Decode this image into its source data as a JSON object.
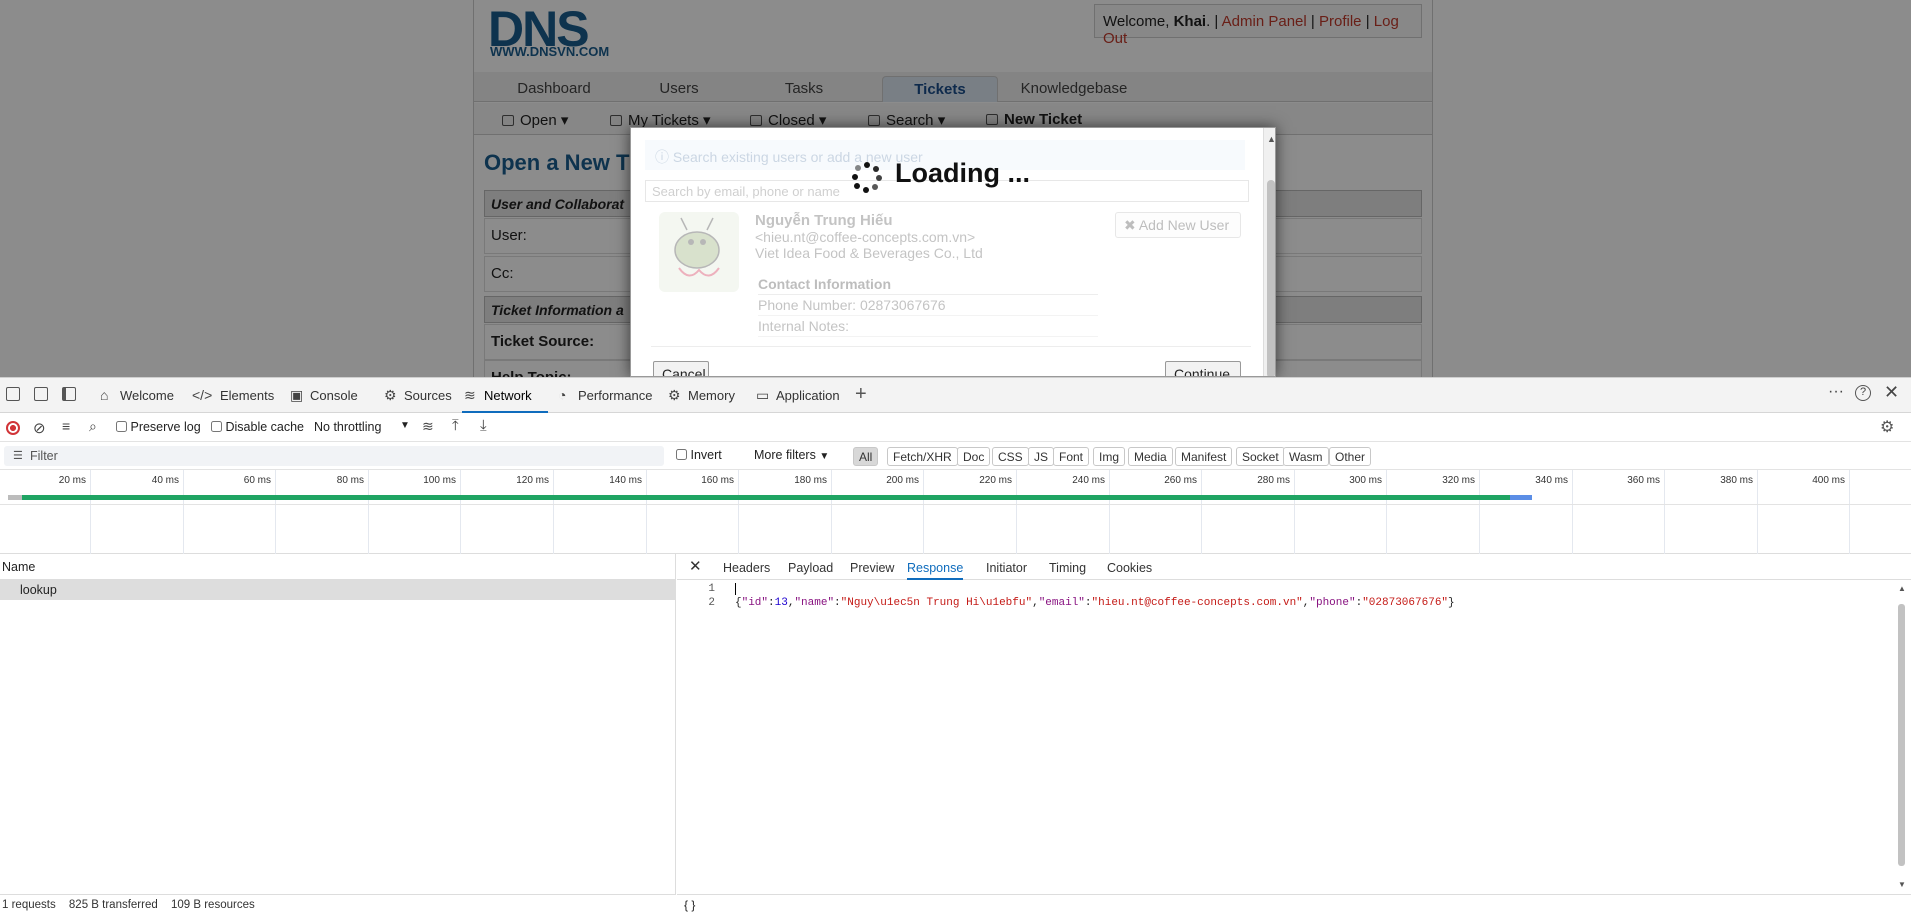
{
  "site": {
    "logo_text": "DNS",
    "logo_url": "WWW.DNSVN.COM",
    "welcome_prefix": "Welcome, ",
    "welcome_user": "Khai",
    "welcome_suffix": ". |",
    "admin_panel": "Admin Panel",
    "profile": "Profile",
    "logout": "Log Out",
    "sep": "|",
    "tabs": [
      "Dashboard",
      "Users",
      "Tasks",
      "Tickets",
      "Knowledgebase"
    ],
    "subnav": [
      "Open ▾",
      "My Tickets ▾",
      "Closed ▾",
      "Search ▾",
      "New Ticket"
    ],
    "page_title": "Open a New Tic",
    "section1": "User and Collaborat",
    "row_user": "User:",
    "row_cc": "Cc:",
    "section2": "Ticket Information a",
    "row_source": "Ticket Source:",
    "row_help": "Help Topic:"
  },
  "modal": {
    "info": "Search existing users or add a new user",
    "search_placeholder": "Search by email, phone or name",
    "user_name": "Nguyễn Trung Hiếu",
    "user_email": "<hieu.nt@coffee-concepts.com.vn>",
    "user_org": "Viet Idea Food & Beverages Co., Ltd",
    "add_new_user": "✖ Add New User",
    "contact_heading": "Contact Information",
    "phone": "Phone Number: 02873067676",
    "notes": "Internal Notes:",
    "cancel": "Cancel",
    "continue": "Continue",
    "loading": "Loading ..."
  },
  "devtools": {
    "tabs": [
      "Welcome",
      "Elements",
      "Console",
      "Sources",
      "Network",
      "Performance",
      "Memory",
      "Application"
    ],
    "active_tab": "Network",
    "toolbar": {
      "preserve_log": "Preserve log",
      "disable_cache": "Disable cache",
      "throttling": "No throttling"
    },
    "filter": {
      "placeholder": "Filter",
      "invert": "Invert",
      "more_filters": "More filters",
      "types": [
        "All",
        "Fetch/XHR",
        "Doc",
        "CSS",
        "JS",
        "Font",
        "Img",
        "Media",
        "Manifest",
        "Socket",
        "Wasm",
        "Other"
      ]
    },
    "timeline_ticks": [
      "20 ms",
      "40 ms",
      "60 ms",
      "80 ms",
      "100 ms",
      "120 ms",
      "140 ms",
      "160 ms",
      "180 ms",
      "200 ms",
      "220 ms",
      "240 ms",
      "260 ms",
      "280 ms",
      "300 ms",
      "320 ms",
      "340 ms",
      "360 ms",
      "380 ms",
      "400 ms"
    ],
    "name_header": "Name",
    "request_name": "lookup",
    "detail_tabs": [
      "Headers",
      "Payload",
      "Preview",
      "Response",
      "Initiator",
      "Timing",
      "Cookies"
    ],
    "active_detail": "Response",
    "line_numbers": [
      "1",
      "2"
    ],
    "response": {
      "id_key": "\"id\"",
      "id_val": "13",
      "name_key": "\"name\"",
      "name_val": "\"Nguy\\u1ec5n Trung Hi\\u1ebfu\"",
      "email_key": "\"email\"",
      "email_val": "\"hieu.nt@coffee-concepts.com.vn\"",
      "phone_key": "\"phone\"",
      "phone_val": "\"02873067676\""
    },
    "status": {
      "requests": "1 requests",
      "transferred": "825 B transferred",
      "resources": "109 B resources"
    },
    "braces": "{ }"
  },
  "colors": {
    "accent": "#0f6cbd",
    "link": "#c0392b",
    "brand": "#1b5e8f",
    "waterfall": "#1fa463"
  }
}
